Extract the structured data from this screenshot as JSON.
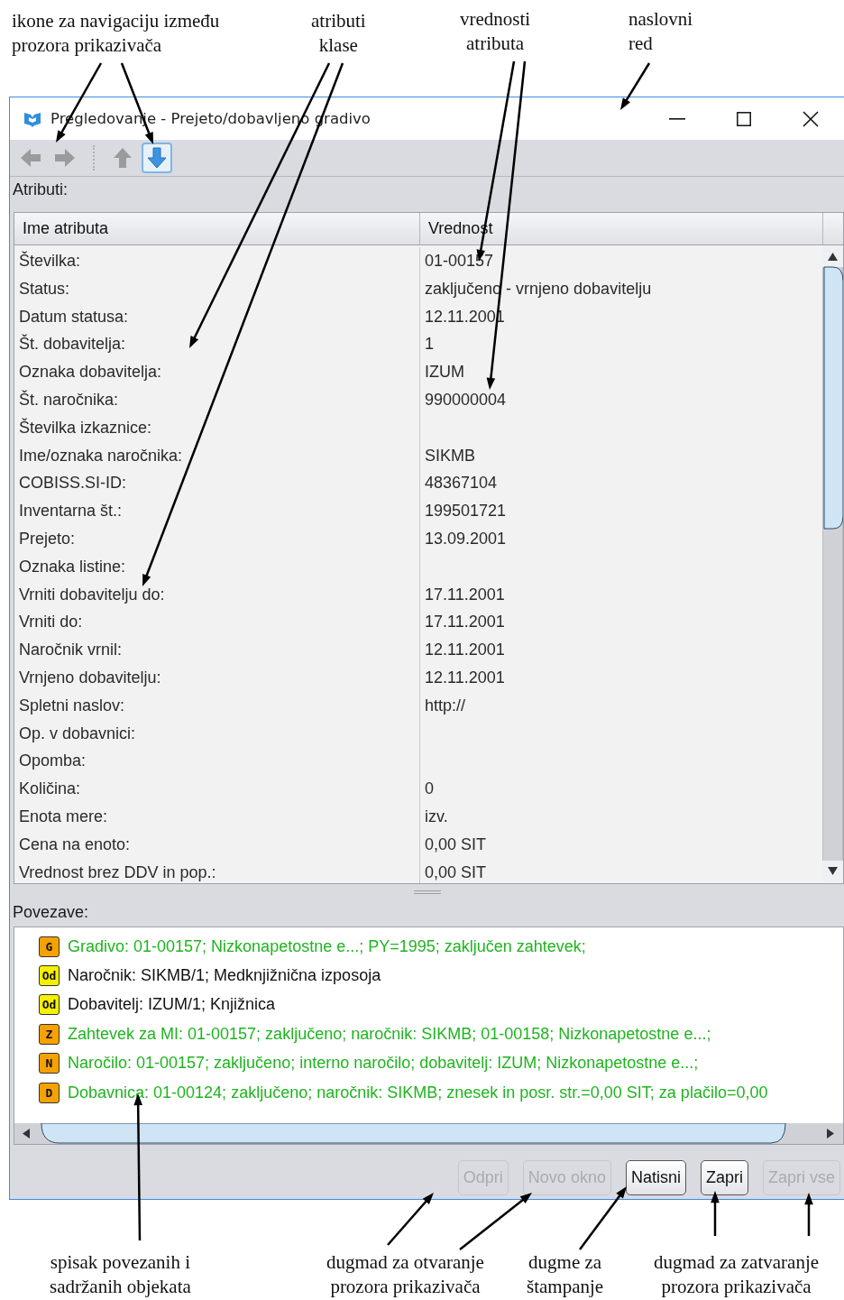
{
  "annotations_top": [
    {
      "text": "ikone za navigaciju između\nprozora prikazivača"
    },
    {
      "text": "atributi\nklase"
    },
    {
      "text": "vrednosti\natributa"
    },
    {
      "text": "naslovni\nred"
    }
  ],
  "window": {
    "title": "Pregledovanje - Prejeto/dobavljeno gradivo"
  },
  "toolbar": [
    {
      "kind": "left",
      "disabled": true,
      "selected": false
    },
    {
      "kind": "right",
      "disabled": true,
      "selected": false
    },
    {
      "kind": "up",
      "disabled": true,
      "selected": false
    },
    {
      "kind": "down",
      "disabled": false,
      "selected": true
    }
  ],
  "attributes_label": "Atributi:",
  "table": {
    "columns": [
      "Ime atributa",
      "Vrednost"
    ],
    "rows": [
      [
        "Številka:",
        "01-00157"
      ],
      [
        "Status:",
        "zaključeno - vrnjeno dobavitelju"
      ],
      [
        "Datum statusa:",
        "12.11.2001"
      ],
      [
        "Št. dobavitelja:",
        "1"
      ],
      [
        "Oznaka dobavitelja:",
        "IZUM"
      ],
      [
        "Št. naročnika:",
        "990000004"
      ],
      [
        "Številka izkaznice:",
        ""
      ],
      [
        "Ime/oznaka naročnika:",
        "SIKMB"
      ],
      [
        "COBISS.SI-ID:",
        "48367104"
      ],
      [
        "Inventarna št.:",
        "199501721"
      ],
      [
        "Prejeto:",
        "13.09.2001"
      ],
      [
        "Oznaka listine:",
        ""
      ],
      [
        "Vrniti dobavitelju do:",
        "17.11.2001"
      ],
      [
        "Vrniti do:",
        "17.11.2001"
      ],
      [
        "Naročnik vrnil:",
        "12.11.2001"
      ],
      [
        "Vrnjeno dobavitelju:",
        "12.11.2001"
      ],
      [
        "Spletni naslov:",
        "http://"
      ],
      [
        "Op. v dobavnici:",
        ""
      ],
      [
        "Opomba:",
        ""
      ],
      [
        "Količina:",
        "0"
      ],
      [
        "Enota mere:",
        "izv."
      ],
      [
        "Cena na enoto:",
        "0,00 SIT"
      ],
      [
        "Vrednost brez DDV in pop.:",
        "0,00 SIT"
      ]
    ]
  },
  "links_label": "Povezave:",
  "links": [
    {
      "badge": "G",
      "color": "#f5a200",
      "kind": "object",
      "text": "Gradivo: 01-00157; Nizkonapetostne e...; PY=1995; zaključen zahtevek;"
    },
    {
      "badge": "Od",
      "color": "#f5f000",
      "kind": "partner",
      "text": "Naročnik: SIKMB/1; Medknjižnična izposoja"
    },
    {
      "badge": "Od",
      "color": "#f5f000",
      "kind": "partner",
      "text": "Dobavitelj: IZUM/1; Knjižnica"
    },
    {
      "badge": "Z",
      "color": "#f5a200",
      "kind": "object",
      "text": "Zahtevek za MI: 01-00157; zaključeno; naročnik: SIKMB; 01-00158; Nizkonapetostne e...;"
    },
    {
      "badge": "N",
      "color": "#f5a200",
      "kind": "object",
      "text": "Naročilo: 01-00157; zaključeno; interno naročilo; dobavitelj: IZUM; Nizkonapetostne e...;"
    },
    {
      "badge": "D",
      "color": "#f5a200",
      "kind": "object",
      "text": "Dobavnica: 01-00124; zaključeno; naročnik: SIKMB; znesek in posr. str.=0,00 SIT; za plačilo=0,00"
    }
  ],
  "buttons": [
    {
      "label": "Odpri",
      "disabled": true
    },
    {
      "label": "Novo okno",
      "disabled": true
    },
    {
      "label": "Natisni",
      "disabled": false
    },
    {
      "label": "Zapri",
      "disabled": false
    },
    {
      "label": "Zapri vse",
      "disabled": true
    }
  ],
  "annotations_bottom": [
    {
      "text": "spisak povezanih i\nsadržanih objekata"
    },
    {
      "text": "dugmad za otvaranje\nprozora prikazivača"
    },
    {
      "text": "dugme za\nštampanje"
    },
    {
      "text": "dugmad za zatvaranje\nprozora prikazivača"
    }
  ]
}
